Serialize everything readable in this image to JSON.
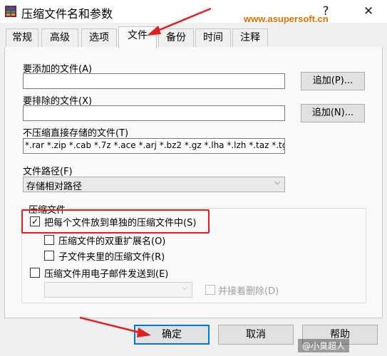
{
  "window": {
    "title": "压缩文件名和参数",
    "watermark": "www.asupersoft.cn"
  },
  "controls": {
    "help": "?",
    "close": "✕"
  },
  "tabs": [
    "常规",
    "高级",
    "选项",
    "文件",
    "备份",
    "时间",
    "注释"
  ],
  "files_tab": {
    "add_files_label": "要添加的文件(A)",
    "add_files_value": "",
    "add_button": "追加(P)...",
    "exclude_files_label": "要排除的文件(X)",
    "exclude_files_value": "",
    "exclude_button": "追加(N)...",
    "store_label": "不压缩直接存储的文件(T)",
    "store_value": "*.rar *.zip *.cab *.7z *.ace *.arj *.bz2 *.gz *.lha *.lzh *.taz *.tg",
    "path_label": "文件路径(F)",
    "path_value": "存储相对路径",
    "archive_group": {
      "title": "压缩文件",
      "put_each_file": {
        "label": "把每个文件放到单独的压缩文件中(S)",
        "checked": true
      },
      "double_ext": {
        "label": "压缩文件的双重扩展名(O)",
        "checked": false
      },
      "subfolders": {
        "label": "子文件夹里的压缩文件(R)",
        "checked": false
      },
      "email": {
        "label": "压缩文件用电子邮件发送到(E)",
        "checked": false
      },
      "email_to": "",
      "delete_after": {
        "label": "并接着删除(D)",
        "checked": false
      }
    }
  },
  "buttons": {
    "ok": "确定",
    "cancel": "取消",
    "help": "帮助"
  },
  "footer_watermark": "@小臭超人",
  "colors": {
    "highlight": "#e02020",
    "watermark": "#e07000"
  }
}
